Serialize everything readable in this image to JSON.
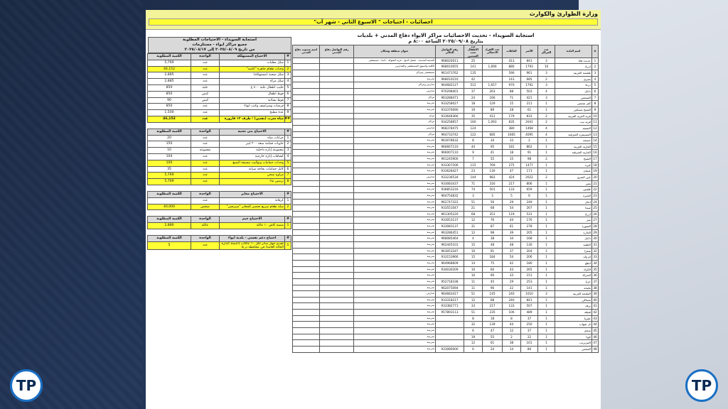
{
  "header": {
    "ministry": "وزارة الطوارئ والكوارث",
    "subtitle": "احصائيات - احتياجات \" الاسبوع الثاني - شهر آب\""
  },
  "main_table": {
    "title": "استجابة السويداء - تحديث الاحصائيات مراكز الايواء دفاع المدني + بلديات",
    "date": "بتاريخ ٢٠٢٥/٠٩/٠٨ الساعة ٨:٠٠ م",
    "columns": [
      "#",
      "اسم البلدة",
      "عدد المراكز",
      "الأسر",
      "العائلات",
      "عدد الافراد الاجمالي",
      "عدد الاطفال تحت السنتين",
      "رقم التواصل الحالي",
      "عنوان منطقة وسكان",
      "رقم التواصل دفاع المدني",
      "اسم مندوب دفاع المدني"
    ],
    "rows": [
      [
        "1",
        "جديدة قانا",
        "3",
        "841",
        "413",
        "",
        "25",
        "968020011",
        "المدينة الجديدة - معمل الدبغ - خربة الشوكه - لاسا - مستشفى",
        "",
        ""
      ],
      [
        "2",
        "ازرع",
        "10",
        "1793",
        "880",
        "1,690",
        "141",
        "968010055",
        "الكلية والسوق المستشفى والمدارس",
        "",
        ""
      ],
      [
        "3",
        "طفسة الغربية",
        "3",
        "961",
        "590",
        "",
        "135",
        "961473762",
        "مستشفى ومراكز",
        "",
        ""
      ],
      [
        "4",
        "بصرى",
        "2",
        "685",
        "143",
        "",
        "42",
        "968010210",
        "مدرسة",
        "",
        ""
      ],
      [
        "5",
        "درعا",
        "3",
        "1792",
        "970",
        "1,657",
        "512",
        "964682127",
        "مدارس ومراكز",
        "",
        ""
      ],
      [
        "6",
        "داعل",
        "4",
        "503",
        "88",
        "263",
        "37",
        "970298401",
        "مدارس",
        "",
        ""
      ],
      [
        "7",
        "الصنمين",
        "3",
        "421",
        "71",
        "166",
        "24",
        "963288471",
        "مراكز",
        "",
        ""
      ],
      [
        "8",
        "كفر شمس",
        "1",
        "211",
        "15",
        "129",
        "18",
        "933258027",
        "مدرسة",
        "",
        ""
      ],
      [
        "9",
        "الشيخ مسكين",
        "1",
        "61",
        "28",
        "89",
        "19",
        "933376090",
        "مدرسة",
        "",
        ""
      ],
      [
        "10",
        "قرية الغرية الغربية",
        "2",
        "833",
        "179",
        "412",
        "35",
        "933648366",
        "مركز",
        "",
        ""
      ],
      [
        "11",
        "قرية بيت",
        "2",
        "2041",
        "835",
        "1,093",
        "160",
        "934258657",
        "مراكز",
        "",
        ""
      ],
      [
        "12",
        "النعيمة",
        "4",
        "1468",
        "380",
        "",
        "124",
        "968378475",
        "مدارس",
        "",
        ""
      ],
      [
        "13",
        "المسيفرة الشرقية",
        "4",
        "4095",
        "1665",
        "685",
        "122",
        "964733742",
        "مراكز",
        "",
        ""
      ],
      [
        "14",
        "جسمة",
        "1",
        "2",
        "33",
        "34",
        "8",
        "963078632",
        "مدرسة",
        "",
        ""
      ],
      [
        "15",
        "الغارية الغربية",
        "1",
        "862",
        "181",
        "95",
        "44",
        "966667110",
        "مدرسة",
        "",
        ""
      ],
      [
        "16",
        "الغارية الشرقية",
        "1",
        "91",
        "18",
        "41",
        "9",
        "966007110",
        "مدرسة",
        "",
        ""
      ],
      [
        "17",
        "الشيخ",
        "2",
        "98",
        "15",
        "55",
        "7",
        "961245900",
        "مدرسة",
        "",
        ""
      ],
      [
        "18",
        "غبرة",
        "1",
        "1477",
        "275",
        "769",
        "115",
        "933307206",
        "مدرسة",
        "",
        ""
      ],
      [
        "19",
        "عتمان",
        "1",
        "171",
        "47",
        "130",
        "23",
        "933628427",
        "مدرسة",
        "",
        ""
      ],
      [
        "20",
        "عين النمرو",
        "2",
        "2022",
        "424",
        "983",
        "144",
        "933236534",
        "مدارس",
        "",
        ""
      ],
      [
        "21",
        "بصر",
        "1",
        "806",
        "217",
        "316",
        "71",
        "933083437",
        "مدرسة",
        "",
        ""
      ],
      [
        "22",
        "طفس",
        "1",
        "659",
        "133",
        "501",
        "74",
        "936853216",
        "مدرسة",
        "",
        ""
      ],
      [
        "23",
        "الجيزة",
        "1",
        "6",
        "5",
        "3",
        "3",
        "964754832",
        "مدرسة",
        "",
        ""
      ],
      [
        "24",
        "انخل",
        "1",
        "249",
        "29",
        "56",
        "51",
        "962747322",
        "مدرسة",
        "",
        ""
      ],
      [
        "25",
        "صيدا",
        "1",
        "267",
        "54",
        "68",
        "21",
        "933551047",
        "مدرسة",
        "",
        ""
      ],
      [
        "26",
        "ازرع",
        "1",
        "531",
        "119",
        "351",
        "68",
        "961305220",
        "مدرسة",
        "",
        ""
      ],
      [
        "27",
        "نمر",
        "1",
        "176",
        "44",
        "76",
        "12",
        "933053137",
        "مدرسة",
        "",
        ""
      ],
      [
        "28",
        "الصورة",
        "1",
        "278",
        "61",
        "87",
        "31",
        "933083137",
        "مدرسة",
        "",
        ""
      ],
      [
        "29",
        "الحارة",
        "1",
        "205",
        "39",
        "98",
        "12",
        "963286451",
        "مدرسة",
        "",
        ""
      ],
      [
        "30",
        "داعل",
        "1",
        "168",
        "34",
        "38",
        "4",
        "968085464",
        "مدرسة",
        "",
        ""
      ],
      [
        "31",
        "الطيبة",
        "1",
        "130",
        "48",
        "48",
        "15",
        "962445101",
        "مدرسة",
        "",
        ""
      ],
      [
        "32",
        "شقرا",
        "1",
        "204",
        "37",
        "91",
        "10",
        "963053187",
        "مدرسة",
        "",
        ""
      ],
      [
        "33",
        "ام ولد",
        "1",
        "206",
        "54",
        "184",
        "15",
        "933153966",
        "مدرسة",
        "",
        ""
      ],
      [
        "34",
        "ابطع",
        "1",
        "180",
        "42",
        "75",
        "14",
        "964968609",
        "مدرسة",
        "",
        ""
      ],
      [
        "35",
        "الكرك",
        "1",
        "265",
        "43",
        "60",
        "10",
        "934030209",
        "مدرسة",
        "",
        ""
      ],
      [
        "36",
        "الحراك",
        "1",
        "151",
        "33",
        "90",
        "10",
        "",
        "مدرسة",
        "",
        ""
      ],
      [
        "37",
        "خربا",
        "1",
        "253",
        "29",
        "45",
        "11",
        "952718338",
        "مدرسة",
        "",
        ""
      ],
      [
        "38",
        "مليحة",
        "1",
        "141",
        "22",
        "96",
        "11",
        "962075094",
        "مدرسة",
        "",
        ""
      ],
      [
        "39",
        "المليحة الغربية",
        "3",
        "1010",
        "240",
        "145",
        "51",
        "964683417",
        "مدارس",
        "",
        ""
      ],
      [
        "40",
        "مساكن",
        "1",
        "841",
        "240",
        "68",
        "12",
        "933318217",
        "مدرسة",
        "",
        ""
      ],
      [
        "41",
        "برقة",
        "1",
        "507",
        "133",
        "217",
        "33",
        "933382771",
        "مدرسة",
        "",
        ""
      ],
      [
        "42",
        "قيطة",
        "1",
        "489",
        "106",
        "235",
        "51",
        "957893113",
        "مدرسة",
        "",
        ""
      ],
      [
        "43",
        "عقربا",
        "1",
        "37",
        "8",
        "18",
        "8",
        "",
        "مدرسة",
        "",
        ""
      ],
      [
        "44",
        "تل شهاب",
        "1",
        "250",
        "44",
        "139",
        "32",
        "",
        "مدرسة",
        "",
        ""
      ],
      [
        "45",
        "سحم",
        "1",
        "37",
        "12",
        "47",
        "6",
        "",
        "مدرسة",
        "",
        ""
      ],
      [
        "46",
        "كويا",
        "1",
        "22",
        "2",
        "55",
        "19",
        "",
        "مدرسة",
        "",
        ""
      ],
      [
        "47",
        "المزيريب",
        "1",
        "101",
        "38",
        "61",
        "12",
        "",
        "مدرسة",
        "",
        ""
      ],
      [
        "48",
        "العجمي",
        "1",
        "80",
        "14",
        "24",
        "6",
        "933080000",
        "مدرسة",
        "",
        ""
      ]
    ]
  },
  "side": {
    "title1": "استجابة السويداء - الاحتياجات المطلوبة",
    "title2": "جميع مراكز ايواء - مستلزمات",
    "title3": "من تاريخ ٢٠٢٥/٠٨/٠٩ إلى ٢٠٢٥/٠٨/١٧",
    "col_num": "#",
    "col_need": "الاحتياج المستهلكة",
    "col_unit": "الواحدة",
    "col_qty": "الكمية المطلوبة",
    "t1": [
      [
        "1",
        "سلل معلبات",
        "عدد",
        "5,769"
      ],
      [
        "2",
        "وجبات طعام جاهزة \"كاسة\"",
        "عدد",
        "46,152"
      ],
      [
        "3",
        "سلل صحية (مستهلكة)",
        "عدد",
        "2,885"
      ],
      [
        "4",
        "سلل مرأة",
        "عدد",
        "2,885"
      ],
      [
        "5",
        "حليب اطفال علبة ٤٠٠ غ",
        "علبة",
        "850"
      ],
      [
        "6",
        "فوط اطفال",
        "كيس",
        "850"
      ],
      [
        "7",
        "فوط نسائية",
        "كيس",
        "90"
      ],
      [
        "8",
        "فرشات وشراشف وكنب ايواء",
        "عدد",
        "850"
      ],
      [
        "9",
        "عدة مطبخ",
        "عدد",
        "1,500"
      ],
      [
        "##",
        "مياه شرب (بقنين) / ظرف ١٢ قارورة",
        "عدد",
        "46,152"
      ]
    ],
    "t2_need": "الاحتياج بني تحتية",
    "t2": [
      [
        "1",
        "خزانات مياه",
        "عدد",
        "20"
      ],
      [
        "2",
        "حاويات قمامة سعة ٢٠٠ ليتر",
        "عدد",
        "150"
      ],
      [
        "3",
        "مجموعة إنارة داخلية",
        "مجموعة",
        "10"
      ],
      [
        "4",
        "كشافات إنارة خارجية",
        "عدد",
        "104"
      ],
      [
        "5",
        "وحدات حمامات وتواليت مسبقة الصنع",
        "عدد",
        "100"
      ],
      [
        "6",
        "كابل حمامات بحاجة صيانة",
        "عدد",
        "35"
      ],
      [
        "7",
        "مراوح شحن",
        "عدد",
        "5,769"
      ],
      [
        "8",
        "ترمس ماء",
        "عدد",
        "5,769"
      ]
    ],
    "t3_need": "الاحتياج معابر",
    "t3": [
      [
        "1",
        "كرفانة",
        "عدد",
        ""
      ],
      [
        "2",
        "سلة طعام سريع تحضير للمعابر \"سيرفس\"",
        "شخص",
        "40,000"
      ]
    ],
    "t4_need": "الاحتياج خيم",
    "t4": [
      [
        "1",
        "منصة كاش ١٠ عائلة",
        "عائلة",
        "2,880"
      ]
    ],
    "t5_need": "احتياج دعم نفسي - بلدية ايواء",
    "t5": [
      [
        "1",
        "تقديم جهاز ساتر لكل ١٠ عائلات (اعتماد الدارة الحالة العامة) في محافظة درعا",
        "عدد",
        "5"
      ]
    ]
  },
  "colors": {
    "highlight": "#ffff33",
    "header_bg": "#f3f39a",
    "logo_ring": "#1a6fc4"
  },
  "logos": {
    "text": "TP"
  }
}
